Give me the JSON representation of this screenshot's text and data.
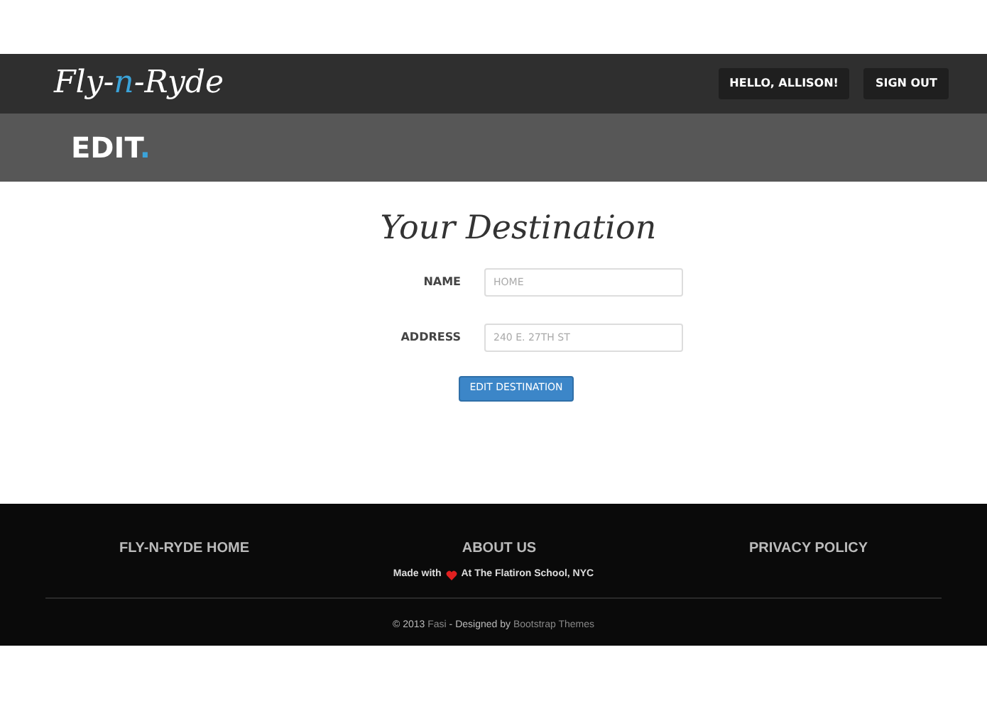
{
  "navbar": {
    "logo": [
      {
        "text": "Fly-",
        "accent": false
      },
      {
        "text": "n",
        "accent": true
      },
      {
        "text": "-Ryde",
        "accent": false
      }
    ],
    "buttons": [
      "HELLO, ALLISON!",
      "SIGN OUT"
    ]
  },
  "page_header": {
    "title": "EDIT",
    "accent": "."
  },
  "form": {
    "heading": "Your Destination",
    "fields": [
      {
        "label": "NAME",
        "placeholder": "HOME"
      },
      {
        "label": "ADDRESS",
        "placeholder": "240 E. 27TH ST"
      }
    ],
    "submit": "EDIT DESTINATION"
  },
  "footer": {
    "links": [
      "FLY-N-RYDE HOME",
      "ABOUT US",
      "PRIVACY POLICY"
    ],
    "made_with": {
      "before": "Made with",
      "after": "At The Flatiron School, NYC"
    },
    "copyright": [
      {
        "text": "© 2013 ",
        "link": false
      },
      {
        "text": "Fasi",
        "link": true
      },
      {
        "text": " - Designed by ",
        "link": false
      },
      {
        "text": "Bootstrap Themes",
        "link": true
      }
    ]
  }
}
